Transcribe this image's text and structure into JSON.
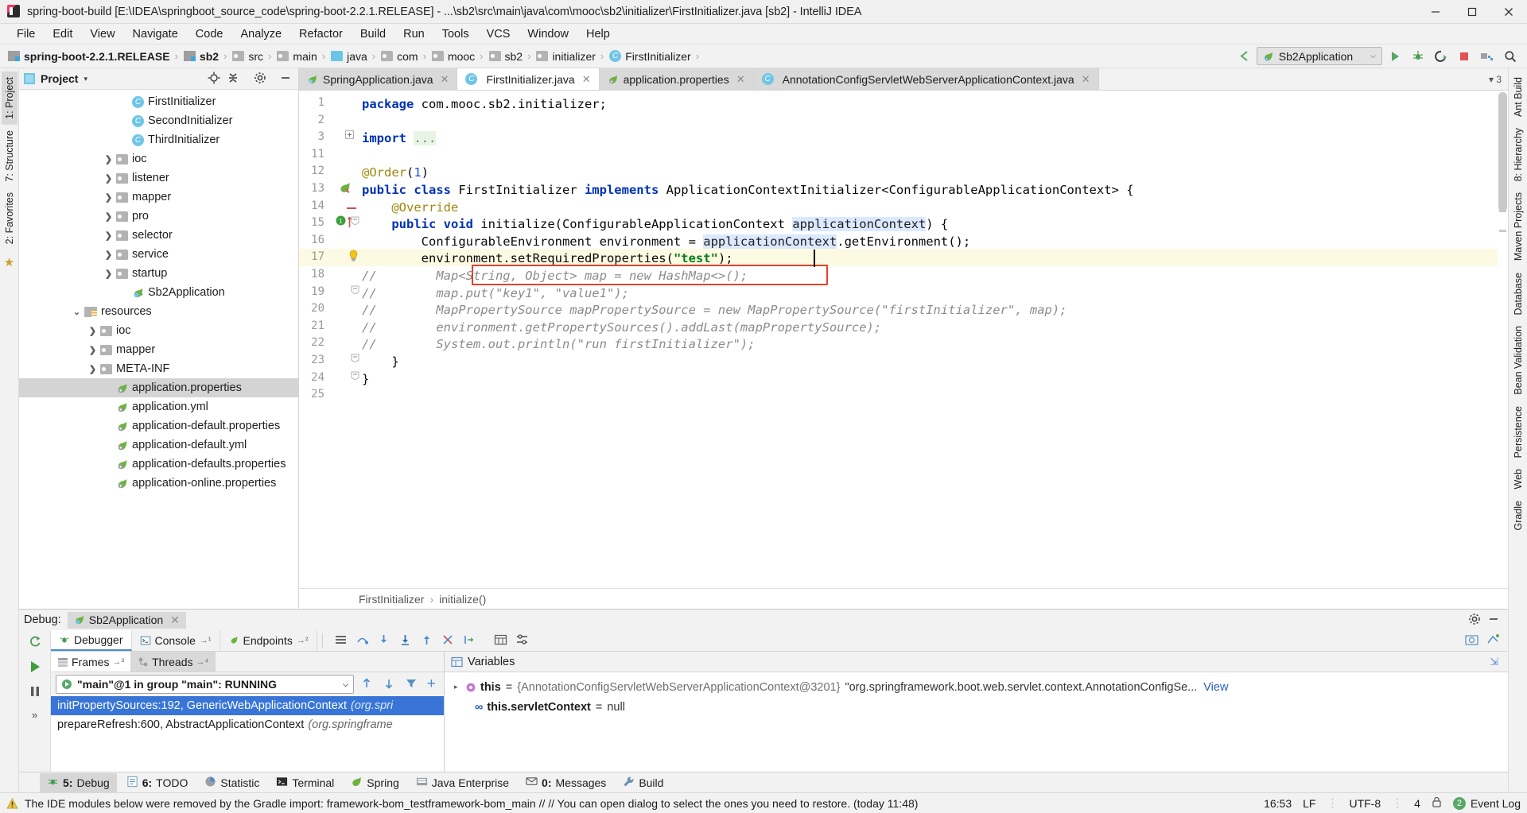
{
  "window": {
    "title": "spring-boot-build [E:\\IDEA\\springboot_source_code\\spring-boot-2.2.1.RELEASE] - ...\\sb2\\src\\main\\java\\com\\mooc\\sb2\\initializer\\FirstInitializer.java [sb2] - IntelliJ IDEA",
    "minimize": "─",
    "maximize": "☐",
    "close": "✕"
  },
  "menubar": {
    "items": [
      "File",
      "Edit",
      "View",
      "Navigate",
      "Code",
      "Analyze",
      "Refactor",
      "Build",
      "Run",
      "Tools",
      "VCS",
      "Window",
      "Help"
    ]
  },
  "navbar": {
    "breadcrumbs": [
      {
        "label": "spring-boot-2.2.1.RELEASE",
        "icon": "module-icon",
        "bold": true
      },
      {
        "label": "sb2",
        "icon": "module-icon",
        "bold": true
      },
      {
        "label": "src",
        "icon": "folder-icon",
        "bold": false
      },
      {
        "label": "main",
        "icon": "folder-icon",
        "bold": false
      },
      {
        "label": "java",
        "icon": "source-folder-icon",
        "bold": false
      },
      {
        "label": "com",
        "icon": "package-icon",
        "bold": false
      },
      {
        "label": "mooc",
        "icon": "package-icon",
        "bold": false
      },
      {
        "label": "sb2",
        "icon": "package-icon",
        "bold": false
      },
      {
        "label": "initializer",
        "icon": "package-icon",
        "bold": false
      },
      {
        "label": "FirstInitializer",
        "icon": "class-icon",
        "bold": false
      }
    ],
    "separator": "›",
    "run_config": "Sb2Application",
    "run_config_caret": "⌵",
    "icons": [
      "back-arrow-icon",
      "run-icon",
      "debug-icon",
      "run-with-coverage-icon",
      "stop-icon",
      "project-structure-icon",
      "search-icon"
    ]
  },
  "left_strip": {
    "tabs": [
      "1: Project",
      "7: Structure",
      "2: Favorites"
    ],
    "star": "★"
  },
  "right_strip": {
    "tabs": [
      "Ant Build",
      "8: Hierarchy",
      "Maven Projects",
      "Database",
      "Bean Validation",
      "Persistence",
      "Web",
      "Gradle"
    ]
  },
  "project_panel": {
    "title": "Project",
    "caret": "▾",
    "header_icons": [
      "locate-icon",
      "collapse-all-icon",
      "settings-icon",
      "hide-icon"
    ],
    "tree": [
      {
        "label": "FirstInitializer",
        "indent": 6,
        "icon": "class-icon",
        "arrow": "",
        "selected": false
      },
      {
        "label": "SecondInitializer",
        "indent": 6,
        "icon": "class-icon",
        "arrow": "",
        "selected": false
      },
      {
        "label": "ThirdInitializer",
        "indent": 6,
        "icon": "class-icon",
        "arrow": "",
        "selected": false
      },
      {
        "label": "ioc",
        "indent": 5,
        "icon": "package-icon",
        "arrow": "❯",
        "selected": false
      },
      {
        "label": "listener",
        "indent": 5,
        "icon": "package-icon",
        "arrow": "❯",
        "selected": false
      },
      {
        "label": "mapper",
        "indent": 5,
        "icon": "package-icon",
        "arrow": "❯",
        "selected": false
      },
      {
        "label": "pro",
        "indent": 5,
        "icon": "package-icon",
        "arrow": "❯",
        "selected": false
      },
      {
        "label": "selector",
        "indent": 5,
        "icon": "package-icon",
        "arrow": "❯",
        "selected": false
      },
      {
        "label": "service",
        "indent": 5,
        "icon": "package-icon",
        "arrow": "❯",
        "selected": false
      },
      {
        "label": "startup",
        "indent": 5,
        "icon": "package-icon",
        "arrow": "❯",
        "selected": false
      },
      {
        "label": "Sb2Application",
        "indent": 6,
        "icon": "spring-class-icon",
        "arrow": "",
        "selected": false
      },
      {
        "label": "resources",
        "indent": 3,
        "icon": "resources-folder-icon",
        "arrow": "⌄",
        "selected": false
      },
      {
        "label": "ioc",
        "indent": 4,
        "icon": "folder-icon",
        "arrow": "❯",
        "selected": false
      },
      {
        "label": "mapper",
        "indent": 4,
        "icon": "folder-icon",
        "arrow": "❯",
        "selected": false
      },
      {
        "label": "META-INF",
        "indent": 4,
        "icon": "folder-icon",
        "arrow": "❯",
        "selected": false
      },
      {
        "label": "application.properties",
        "indent": 5,
        "icon": "spring-file-icon",
        "arrow": "",
        "selected": true
      },
      {
        "label": "application.yml",
        "indent": 5,
        "icon": "spring-file-icon",
        "arrow": "",
        "selected": false
      },
      {
        "label": "application-default.properties",
        "indent": 5,
        "icon": "spring-file-icon",
        "arrow": "",
        "selected": false
      },
      {
        "label": "application-default.yml",
        "indent": 5,
        "icon": "spring-file-icon",
        "arrow": "",
        "selected": false
      },
      {
        "label": "application-defaults.properties",
        "indent": 5,
        "icon": "spring-file-icon",
        "arrow": "",
        "selected": false
      },
      {
        "label": "application-online.properties",
        "indent": 5,
        "icon": "spring-file-icon",
        "arrow": "",
        "selected": false
      }
    ]
  },
  "editor": {
    "tabs": [
      {
        "label": "SpringApplication.java",
        "icon": "spring-class-icon",
        "active": false,
        "close": "✕"
      },
      {
        "label": "FirstInitializer.java",
        "icon": "class-icon",
        "active": true,
        "close": "✕"
      },
      {
        "label": "application.properties",
        "icon": "spring-file-icon",
        "active": false,
        "close": "✕"
      },
      {
        "label": "AnnotationConfigServletWebServerApplicationContext.java",
        "icon": "class-icon",
        "active": false,
        "close": "✕"
      }
    ],
    "tabs_right": "▾ 3",
    "line_numbers": [
      "1",
      "2",
      "3",
      "11",
      "12",
      "13",
      "14",
      "15",
      "16",
      "17",
      "18",
      "19",
      "20",
      "21",
      "22",
      "23",
      "24",
      "25"
    ],
    "code_lines": [
      {
        "n": "1",
        "html": "<span class=\"kw\">package</span> <span class=\"pln\">com.mooc.sb2.initializer;</span>"
      },
      {
        "n": "2",
        "html": ""
      },
      {
        "n": "3",
        "html": "<span class=\"kw\">import</span> <span style=\"background:#e8f5e4;color:#7a7a7a\">...</span>"
      },
      {
        "n": "11",
        "html": ""
      },
      {
        "n": "12",
        "html": "<span class=\"ann\">@Order</span><span class=\"pln\">(</span><span class=\"num\">1</span><span class=\"pln\">)</span>"
      },
      {
        "n": "13",
        "html": "<span class=\"kw\">public class</span> <span class=\"pln\">FirstInitializer </span><span class=\"kw\">implements</span> <span class=\"pln\">ApplicationContextInitializer&lt;ConfigurableApplicationContext&gt; {</span>"
      },
      {
        "n": "14",
        "html": "    <span class=\"ann\">@Override</span>"
      },
      {
        "n": "15",
        "html": "    <span class=\"kw\">public void</span> <span class=\"pln\">initialize(ConfigurableApplicationContext </span><span class=\"hl-ident\">applicationContext</span><span class=\"pln\">) {</span>"
      },
      {
        "n": "16",
        "html": "        <span class=\"pln\">ConfigurableEnvironment environment = </span><span class=\"hl-ident\">applicationContext</span><span class=\"pln\">.getEnvironment();</span>"
      },
      {
        "n": "17",
        "html": "        <span class=\"pln\">environment.setRequiredProperties(</span><span class=\"str\">\"test\"</span><span class=\"pln\">);</span>"
      },
      {
        "n": "18",
        "html": "<span class=\"cmt\">//        Map&lt;String, Object&gt; map = new HashMap&lt;&gt;();</span>"
      },
      {
        "n": "19",
        "html": "<span class=\"cmt\">//        map.put(\"key1\", \"value1\");</span>"
      },
      {
        "n": "20",
        "html": "<span class=\"cmt\">//        MapPropertySource mapPropertySource = new MapPropertySource(\"firstInitializer\", map);</span>"
      },
      {
        "n": "21",
        "html": "<span class=\"cmt\">//        environment.getPropertySources().addLast(mapPropertySource);</span>"
      },
      {
        "n": "22",
        "html": "<span class=\"cmt\">//        System.out.println(\"run firstInitializer\");</span>"
      },
      {
        "n": "23",
        "html": "    <span class=\"pln\">}</span>"
      },
      {
        "n": "24",
        "html": "<span class=\"pln\">}</span>"
      },
      {
        "n": "25",
        "html": ""
      }
    ],
    "bottom_breadcrumb": [
      "FirstInitializer",
      "initialize()"
    ],
    "bottom_breadcrumb_sep": "›"
  },
  "debug": {
    "label": "Debug:",
    "session_tab": "Sb2Application",
    "session_close": "✕",
    "toolbar_icons": [
      "settings-icon",
      "hide-icon"
    ],
    "tabs": [
      {
        "label": "Debugger",
        "icon": "debugger-icon",
        "active": true
      },
      {
        "label": "Console",
        "icon": "console-icon",
        "active": false,
        "suffix": "→¹"
      },
      {
        "label": "Endpoints",
        "icon": "endpoints-icon",
        "active": false,
        "suffix": "→²"
      }
    ],
    "step_icons": [
      "show-execution-point-icon",
      "step-over-icon",
      "step-into-icon",
      "force-step-into-icon",
      "step-out-icon",
      "drop-frame-icon",
      "run-to-cursor-icon",
      "evaluate-icon",
      "settings-icon"
    ],
    "left_icons": [
      "rerun-icon",
      "resume-icon",
      "pause-icon",
      "more-icon"
    ],
    "frames_panel": {
      "tabs": [
        {
          "label": "Frames",
          "active": true,
          "suffix": "→³"
        },
        {
          "label": "Threads",
          "active": false,
          "suffix": "→⁴"
        }
      ],
      "thread_selector": "\"main\"@1 in group \"main\": RUNNING",
      "thread_caret": "⌵",
      "toolbar_icons": [
        "up-arrow-icon",
        "down-arrow-icon",
        "filter-icon"
      ],
      "rows": [
        {
          "text": "initPropertySources:192, GenericWebApplicationContext",
          "italic": "(org.spri",
          "selected": true
        },
        {
          "text": "prepareRefresh:600, AbstractApplicationContext",
          "italic": "(org.springframe",
          "selected": false
        }
      ],
      "side_icons": [
        "plus-icon",
        "minus-icon",
        "more-icon"
      ]
    },
    "variables_panel": {
      "title": "Variables",
      "expand_icon": "⇲",
      "rows": [
        {
          "tri": "▸",
          "icon": "object-icon",
          "name": "this",
          "eq": "=",
          "brace": "{AnnotationConfigServletWebServerApplicationContext@3201}",
          "value": "\"org.springframework.boot.web.servlet.context.AnnotationConfigSe...",
          "link": "View"
        },
        {
          "tri": "",
          "icon": "field-icon",
          "name": "this.servletContext",
          "eq": "=",
          "brace": "",
          "value": "null",
          "link": ""
        }
      ]
    }
  },
  "bottom_tabs": [
    {
      "num": "5:",
      "label": "Debug",
      "icon": "debug-icon",
      "selected": true
    },
    {
      "num": "6:",
      "label": "TODO",
      "icon": "todo-icon",
      "selected": false
    },
    {
      "num": "",
      "label": "Statistic",
      "icon": "statistic-icon",
      "selected": false
    },
    {
      "num": "",
      "label": "Terminal",
      "icon": "terminal-icon",
      "selected": false
    },
    {
      "num": "",
      "label": "Spring",
      "icon": "spring-icon",
      "selected": false
    },
    {
      "num": "",
      "label": "Java Enterprise",
      "icon": "java-ee-icon",
      "selected": false
    },
    {
      "num": "0:",
      "label": "Messages",
      "icon": "messages-icon",
      "selected": false
    },
    {
      "num": "",
      "label": "Build",
      "icon": "build-icon",
      "selected": false
    }
  ],
  "statusbar": {
    "message": "The IDE modules below were removed by the Gradle import: framework-bom_testframework-bom_main // // You can open dialog to select the ones you need to restore. (today 11:48)",
    "warn_icon": "warning-icon",
    "time": "16:53",
    "line_sep": "LF",
    "encoding": "UTF-8",
    "indent": "4",
    "lock_icon": "lock-icon",
    "event_log": "Event Log",
    "event_badge": "2"
  },
  "colors": {
    "accent_blue": "#3875d6",
    "spring_green": "#6db33f",
    "error_red": "#e8412b",
    "keyword_blue": "#0033b3",
    "string_green": "#067d17",
    "comment_gray": "#8c8c8c",
    "panel_bg": "#f2f2f2",
    "selection_gray": "#d4d4d4"
  }
}
